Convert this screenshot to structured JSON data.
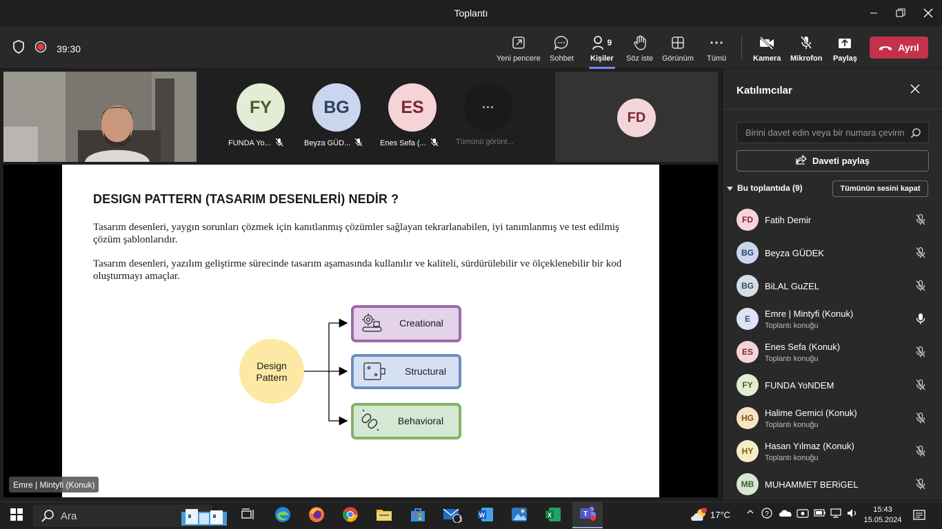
{
  "window": {
    "title": "Toplantı"
  },
  "toolbar": {
    "timer": "39:30",
    "buttons": {
      "new_window": "Yeni pencere",
      "chat": "Sohbet",
      "people": "Kişiler",
      "people_count": "9",
      "raise_hand": "Söz iste",
      "view": "Görünüm",
      "more": "Tümü",
      "camera": "Kamera",
      "mic": "Mikrofon",
      "share": "Paylaş",
      "leave": "Ayrıl"
    }
  },
  "roster": [
    {
      "initials": "FY",
      "label": "FUNDA Yo...",
      "bg": "#e3ecd5",
      "fg": "#4a5a2e"
    },
    {
      "initials": "BG",
      "label": "Beyza GÜD...",
      "bg": "#c9d6ee",
      "fg": "#2d3e66"
    },
    {
      "initials": "ES",
      "label": "Enes Sefa (...",
      "bg": "#f5d3d6",
      "fg": "#7d2632"
    },
    {
      "initials": "···",
      "label": "Tümünü görünt...",
      "bg": "#1a1a1a",
      "fg": "#bbbbbb"
    }
  ],
  "fd_tile": {
    "initials": "FD",
    "bg": "#f3d6d9",
    "fg": "#7d2632"
  },
  "slide": {
    "title": "DESIGN PATTERN (TASARIM DESENLERİ) NEDİR ?",
    "para1": "Tasarım desenleri, yaygın sorunları çözmek için kanıtlanmış çözümler sağlayan tekrarlanabilen, iyi tanımlanmış ve test edilmiş çözüm şablonlarıdır.",
    "para2": "Tasarım desenleri, yazılım geliştirme sürecinde tasarım aşamasında kullanılır ve kaliteli, sürdürülebilir ve ölçeklenebilir bir kod oluşturmayı amaçlar.",
    "diagram": {
      "root_line1": "Design",
      "root_line2": "Pattern",
      "creational": "Creational",
      "structural": "Structural",
      "behavioral": "Behavioral"
    }
  },
  "presenter_tag": "Emre | Mintyfi (Konuk)",
  "panel": {
    "title": "Katılımcılar",
    "invite_placeholder": "Birini davet edin veya bir numara çevirin",
    "share_invite": "Daveti paylaş",
    "section_label": "Bu toplantıda (9)",
    "mute_all": "Tümünün sesini kapat",
    "guest_label": "Toplantı konuğu",
    "participants": [
      {
        "initials": "FD",
        "name": "Fatih Demir",
        "sub": "",
        "bg": "#f3d6d9",
        "fg": "#7d2632",
        "mic": "muted"
      },
      {
        "initials": "BG",
        "name": "Beyza GÜDEK",
        "sub": "",
        "bg": "#c9d6ee",
        "fg": "#2d3e66",
        "mic": "muted"
      },
      {
        "initials": "BG",
        "name": "BiLAL GuZEL",
        "sub": "",
        "bg": "#d5dde8",
        "fg": "#3a4a5e",
        "mic": "muted"
      },
      {
        "initials": "E",
        "name": "Emre | Mintyfi (Konuk)",
        "sub": "Toplantı konuğu",
        "bg": "#dce3f2",
        "fg": "#3a4a7e",
        "mic": "on"
      },
      {
        "initials": "ES",
        "name": "Enes Sefa (Konuk)",
        "sub": "Toplantı konuğu",
        "bg": "#f5d3d6",
        "fg": "#7d2632",
        "mic": "muted"
      },
      {
        "initials": "FY",
        "name": "FUNDA YoNDEM",
        "sub": "",
        "bg": "#e3ecd5",
        "fg": "#4a5a2e",
        "mic": "muted"
      },
      {
        "initials": "HG",
        "name": "Halime Gemici (Konuk)",
        "sub": "Toplantı konuğu",
        "bg": "#f7e3c4",
        "fg": "#7a4f14",
        "mic": "muted"
      },
      {
        "initials": "HY",
        "name": "Hasan Yılmaz (Konuk)",
        "sub": "Toplantı konuğu",
        "bg": "#f7edc4",
        "fg": "#6f5a10",
        "mic": "muted"
      },
      {
        "initials": "MB",
        "name": "MUHAMMET BERiGEL",
        "sub": "",
        "bg": "#d6e8d0",
        "fg": "#3b5a30",
        "mic": "muted"
      }
    ]
  },
  "taskbar": {
    "search": "Ara",
    "weather": "17°C",
    "time": "15:43",
    "date": "15.05.2024",
    "mail_badge": "1"
  }
}
